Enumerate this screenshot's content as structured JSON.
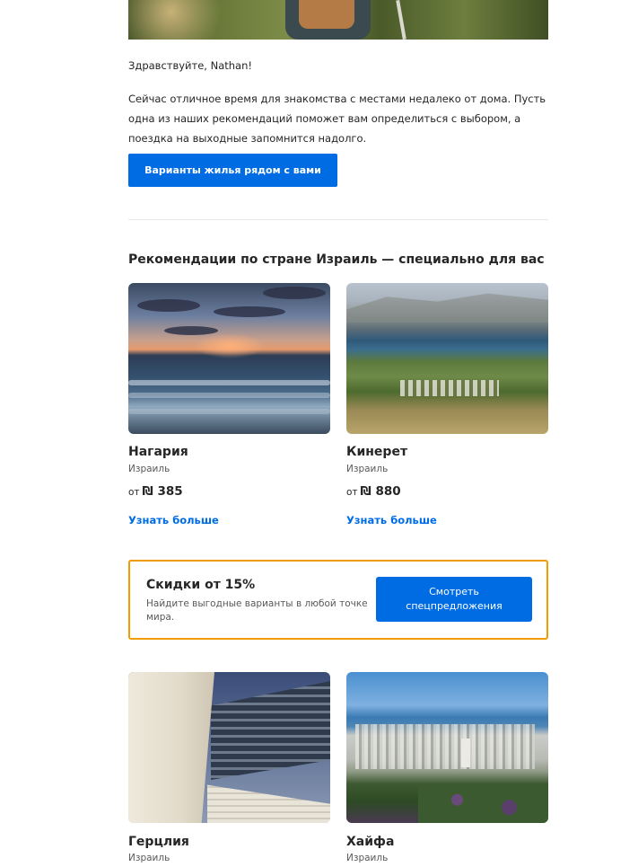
{
  "greeting": "Здравствуйте, Nathan!",
  "intro": "Сейчас отличное время для знакомства с местами недалеко от дома. Пусть одна из наших рекомендаций поможет вам определиться с выбором, а поездка на выходные запомнится надолго.",
  "primary_cta": "Варианты жилья рядом с вами",
  "section_title": "Рекомендации по стране Израиль — специально для вас",
  "cards": [
    {
      "name": "Нагария",
      "country": "Израиль",
      "price_prefix": "от",
      "price": "₪ 385",
      "link": "Узнать больше"
    },
    {
      "name": "Кинерет",
      "country": "Израиль",
      "price_prefix": "от",
      "price": "₪ 880",
      "link": "Узнать больше"
    },
    {
      "name": "Герцлия",
      "country": "Израиль"
    },
    {
      "name": "Хайфа",
      "country": "Израиль"
    }
  ],
  "promo": {
    "title": "Скидки от 15%",
    "text": "Найдите выгодные варианты в любой точке мира.",
    "button": "Смотреть спецпредложения"
  },
  "colors": {
    "accent": "#006ce4",
    "promo_border": "#f09b00",
    "text": "#262626",
    "muted": "#595959"
  }
}
